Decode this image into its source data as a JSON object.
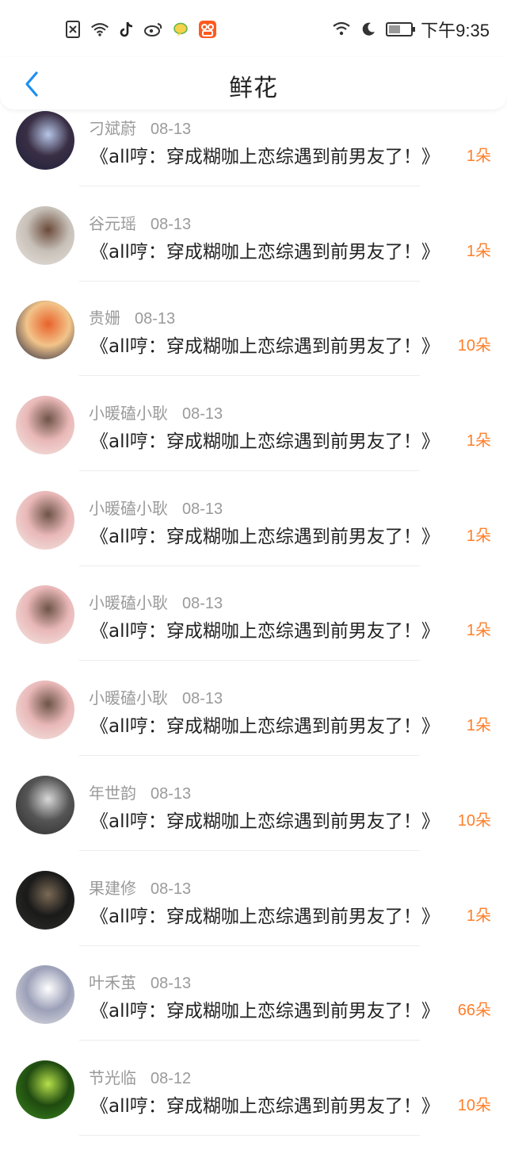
{
  "status_bar": {
    "time": "下午9:35",
    "left_icons": [
      "no-sim-icon",
      "wifi-speed-icon",
      "tiktok-icon",
      "weibo-icon",
      "chat-bubble-icon",
      "kuaishou-icon"
    ],
    "right_icons": [
      "wifi-icon",
      "moon-icon",
      "battery-icon"
    ],
    "battery_level": 0.45
  },
  "nav": {
    "title": "鲜花",
    "back_icon": "chevron-left-icon"
  },
  "items": [
    {
      "name": "刁斌蔚",
      "date": "08-13",
      "book": "《all哼：穿成糊咖上恋综遇到前男友了！》",
      "flowers": "1朵",
      "avatar_colors": [
        "#1a1f3a",
        "#b7c6e8",
        "#3a2f45"
      ]
    },
    {
      "name": "谷元瑶",
      "date": "08-13",
      "book": "《all哼：穿成糊咖上恋综遇到前男友了！》",
      "flowers": "1朵",
      "avatar_colors": [
        "#e9e4df",
        "#6b4a3a",
        "#c7c0b8"
      ]
    },
    {
      "name": "贵姗",
      "date": "08-13",
      "book": "《all哼：穿成糊咖上恋综遇到前男友了！》",
      "flowers": "10朵",
      "avatar_colors": [
        "#0f1535",
        "#e8622b",
        "#f2c48a"
      ]
    },
    {
      "name": "小暖磕小耿",
      "date": "08-13",
      "book": "《all哼：穿成糊咖上恋综遇到前男友了！》",
      "flowers": "1朵",
      "avatar_colors": [
        "#f3ebe5",
        "#6e5448",
        "#e9b8b8"
      ]
    },
    {
      "name": "小暖磕小耿",
      "date": "08-13",
      "book": "《all哼：穿成糊咖上恋综遇到前男友了！》",
      "flowers": "1朵",
      "avatar_colors": [
        "#f3ebe5",
        "#6e5448",
        "#e9b8b8"
      ]
    },
    {
      "name": "小暖磕小耿",
      "date": "08-13",
      "book": "《all哼：穿成糊咖上恋综遇到前男友了！》",
      "flowers": "1朵",
      "avatar_colors": [
        "#f3ebe5",
        "#6e5448",
        "#e9b8b8"
      ]
    },
    {
      "name": "小暖磕小耿",
      "date": "08-13",
      "book": "《all哼：穿成糊咖上恋综遇到前男友了！》",
      "flowers": "1朵",
      "avatar_colors": [
        "#f3ebe5",
        "#6e5448",
        "#e9b8b8"
      ]
    },
    {
      "name": "年世韵",
      "date": "08-13",
      "book": "《all哼：穿成糊咖上恋综遇到前男友了！》",
      "flowers": "10朵",
      "avatar_colors": [
        "#2a2a2a",
        "#d8d8d8",
        "#555555"
      ]
    },
    {
      "name": "果建修",
      "date": "08-13",
      "book": "《all哼：穿成糊咖上恋综遇到前男友了！》",
      "flowers": "1朵",
      "avatar_colors": [
        "#2f2f2a",
        "#7b6a55",
        "#1a1a1a"
      ]
    },
    {
      "name": "叶禾茧",
      "date": "08-13",
      "book": "《all哼：穿成糊咖上恋综遇到前男友了！》",
      "flowers": "66朵",
      "avatar_colors": [
        "#e6e6e6",
        "#ffffff",
        "#9ca0b8"
      ]
    },
    {
      "name": "节光临",
      "date": "08-12",
      "book": "《all哼：穿成糊咖上恋综遇到前男友了！》",
      "flowers": "10朵",
      "avatar_colors": [
        "#3d8a1e",
        "#b6e04a",
        "#1f4a10"
      ]
    }
  ],
  "colors": {
    "accent_blue": "#1e8ff0",
    "flower_orange": "#ff7f2a",
    "meta_gray": "#9a9a9a"
  }
}
